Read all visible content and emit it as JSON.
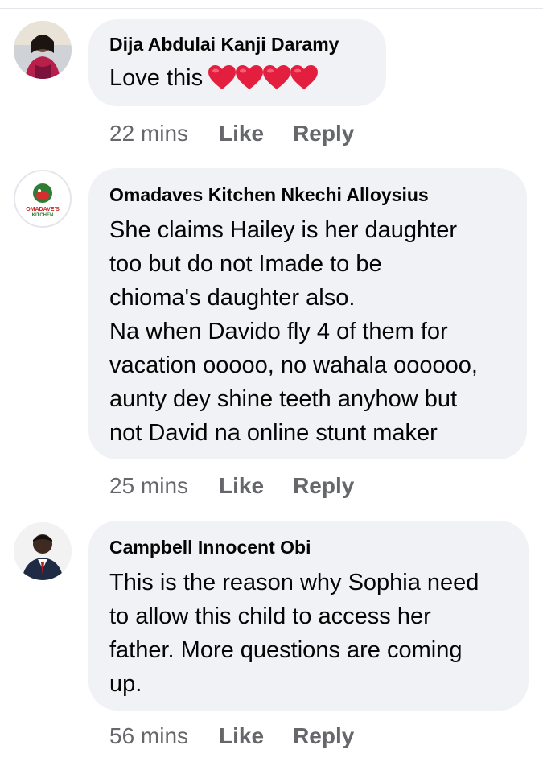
{
  "comments": [
    {
      "author": "Dija Abdulai Kanji Daramy",
      "text": "Love this",
      "emoji": [
        "heart-icon",
        "heart-icon",
        "heart-icon",
        "heart-icon"
      ],
      "time": "22 mins",
      "like_label": "Like",
      "reply_label": "Reply"
    },
    {
      "author": "Omadaves Kitchen Nkechi Alloysius",
      "avatar_logo_text": "OMADAVE'S KITCHEN",
      "lines": [
        "She claims Hailey is her daughter",
        "too but do not Imade to be",
        "chioma's daughter also.",
        "Na when Davido fly 4 of them for",
        "vacation ooooo, no wahala oooooo,",
        "aunty dey shine teeth anyhow but",
        "not David na online stunt maker"
      ],
      "time": "25 mins",
      "like_label": "Like",
      "reply_label": "Reply"
    },
    {
      "author": "Campbell Innocent Obi",
      "lines": [
        "This is the reason why Sophia need",
        "to allow this child to access her",
        "father. More questions are coming",
        "up."
      ],
      "time": "56 mins",
      "like_label": "Like",
      "reply_label": "Reply"
    }
  ],
  "colors": {
    "bubble": "#f0f2f5",
    "meta_text": "#65676b",
    "heart": "#e41e3f"
  }
}
